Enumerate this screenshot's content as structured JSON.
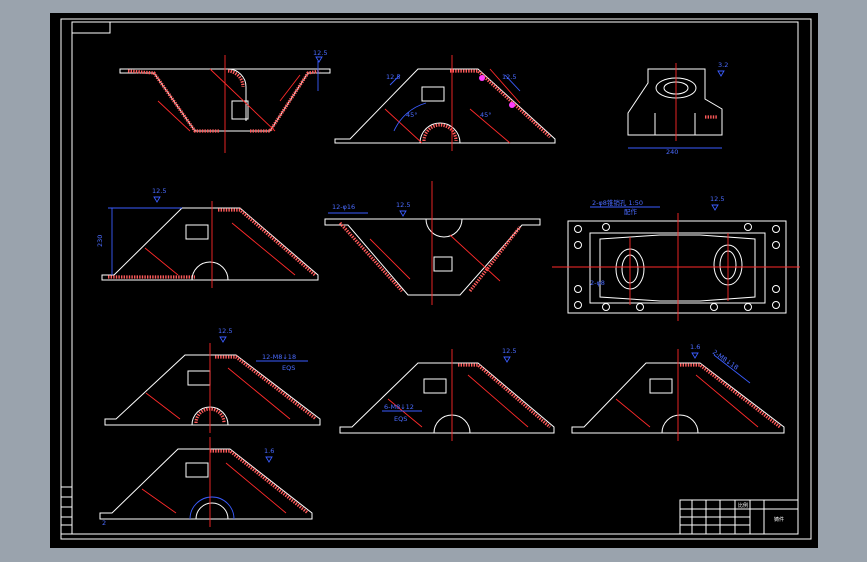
{
  "drawing": {
    "background": "#000000",
    "frame_color": "#ffffff",
    "centerline_color": "#ff2a2a",
    "dimension_color": "#3a5cff",
    "title_block_text": "比例",
    "title_block_sub": "铸件"
  },
  "annotations": {
    "roughness_1": "12.5",
    "roughness_2": "12.5",
    "roughness_3": "12.5",
    "roughness_4": "12.5",
    "roughness_5": "12.5",
    "roughness_6": "1.6",
    "roughness_7": "1.6",
    "roughness_8": "3.2",
    "roughness_9": "12.5",
    "roughness_10": "12.5",
    "roughness_11": "12.5",
    "dim_230": "230",
    "dim_240": "240",
    "dim_12_phi16": "12-φ16",
    "dim_2_phi8": "2-φ8锥销孔 1:50",
    "dim_2_phi8_sub": "配作",
    "dim_12_m8": "12-M8↓18",
    "dim_12_m8_sub": "EQS",
    "dim_6_m8": "6-M8↓12",
    "dim_6_m8_sub": "EQS",
    "dim_2_m8": "2-M8↓18",
    "dim_2_m8_sub": "配作",
    "dim_45a": "45°",
    "dim_45b": "45°",
    "dim_2phi8": "2-φ8",
    "corner_label": "2"
  }
}
